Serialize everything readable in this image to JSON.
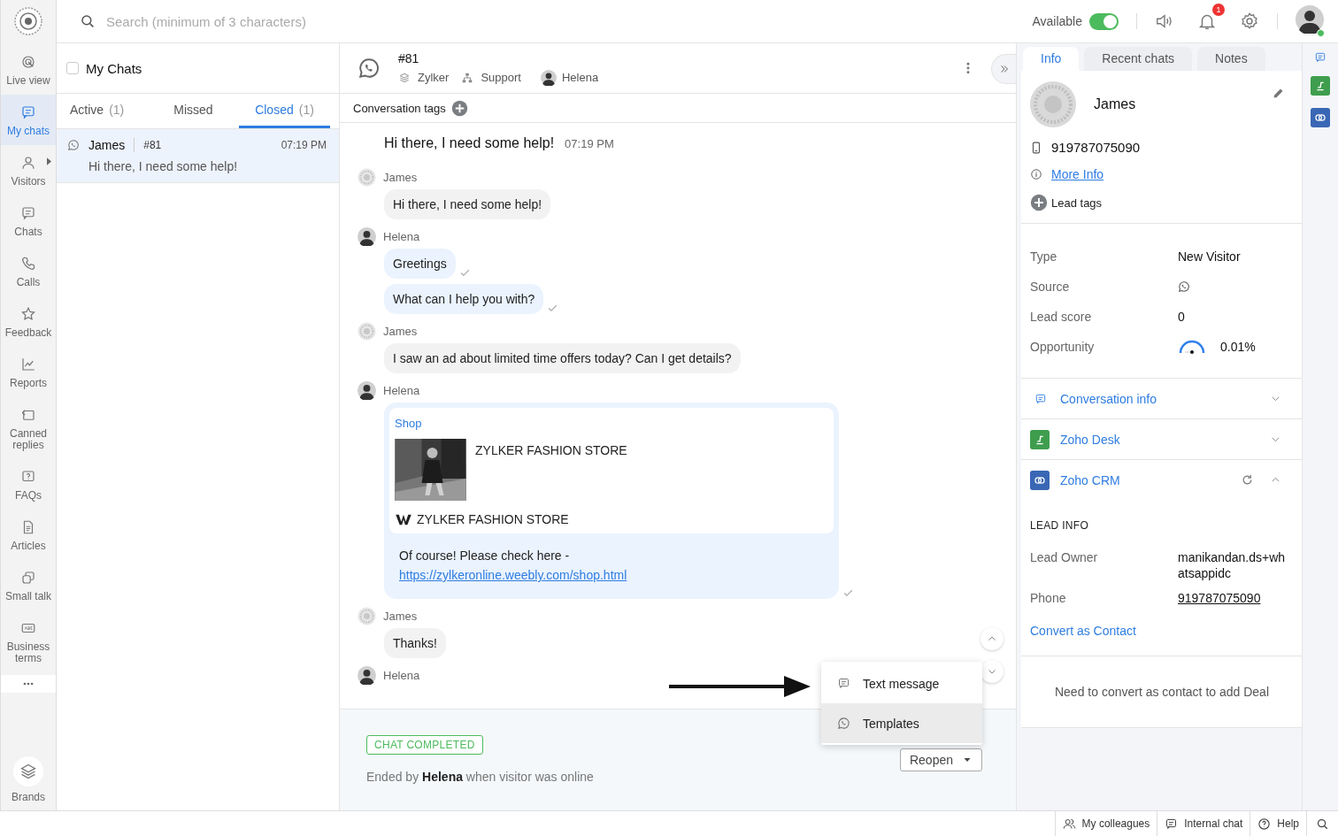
{
  "nav": {
    "items": [
      {
        "label": "Live view",
        "selected": false,
        "has_submenu": false
      },
      {
        "label": "My chats",
        "selected": true,
        "has_submenu": false
      },
      {
        "label": "Visitors",
        "selected": false,
        "has_submenu": true
      },
      {
        "label": "Chats",
        "selected": false,
        "has_submenu": false
      },
      {
        "label": "Calls",
        "selected": false,
        "has_submenu": false
      },
      {
        "label": "Feedback",
        "selected": false,
        "has_submenu": false
      },
      {
        "label": "Reports",
        "selected": false,
        "has_submenu": false
      },
      {
        "label": "Canned replies",
        "selected": false,
        "has_submenu": false
      },
      {
        "label": "FAQs",
        "selected": false,
        "has_submenu": false
      },
      {
        "label": "Articles",
        "selected": false,
        "has_submenu": false
      },
      {
        "label": "Small talk",
        "selected": false,
        "has_submenu": false
      },
      {
        "label": "Business terms",
        "selected": false,
        "has_submenu": false
      }
    ],
    "bottom_item": {
      "label": "Brands"
    }
  },
  "topbar": {
    "search": {
      "placeholder": "Search (minimum of 3 characters)"
    },
    "availability": {
      "label": "Available",
      "on": true
    },
    "notification_count": "1"
  },
  "chat_list": {
    "title": "My Chats",
    "select_all_checked": false,
    "tabs": [
      {
        "label": "Active",
        "count": "(1)",
        "selected": false
      },
      {
        "label": "Missed",
        "selected": false
      },
      {
        "label": "Closed",
        "count": "(1)",
        "selected": true
      }
    ],
    "chats": [
      {
        "name": "James",
        "number": "#81",
        "time": "07:19 PM",
        "preview": "Hi there, I need some help!",
        "selected": true
      }
    ]
  },
  "conversation": {
    "number": "#81",
    "brand": "Zylker",
    "department": "Support",
    "agent": "Helena",
    "tags_label": "Conversation tags",
    "messages": [
      {
        "kind": "headline",
        "text": "Hi there, I need some help!",
        "time": "07:19 PM"
      },
      {
        "kind": "group",
        "sender": "James",
        "from_agent": false,
        "bubbles": [
          {
            "text": "Hi there, I need some help!",
            "delivered": false
          }
        ]
      },
      {
        "kind": "group",
        "sender": "Helena",
        "from_agent": true,
        "bubbles": [
          {
            "text": "Greetings",
            "delivered": true
          },
          {
            "text": "What can I help you with?",
            "delivered": true
          }
        ]
      },
      {
        "kind": "group",
        "sender": "James",
        "from_agent": false,
        "bubbles": [
          {
            "text": "I saw an ad about limited time offers today? Can I get details?",
            "delivered": false
          }
        ]
      },
      {
        "kind": "card",
        "sender": "Helena",
        "from_agent": true,
        "link_label": "Shop",
        "product_title": "ZYLKER FASHION STORE",
        "store_name": "ZYLKER FASHION STORE",
        "text": "Of course! Please check here -",
        "url": "https://zylkeronline.weebly.com/shop.html",
        "delivered": true
      },
      {
        "kind": "group",
        "sender": "James",
        "from_agent": false,
        "bubbles": [
          {
            "text": "Thanks!",
            "delivered": false
          }
        ]
      },
      {
        "kind": "group",
        "sender": "Helena",
        "from_agent": true
      }
    ],
    "reply_menu": [
      {
        "label": "Text message",
        "highlighted": false,
        "kind": "text"
      },
      {
        "label": "Templates",
        "highlighted": true,
        "kind": "whatsapp"
      }
    ],
    "footer": {
      "status": "CHAT COMPLETED",
      "ended_text": "Ended by **Helena** when visitor was online",
      "reopen_label": "Reopen"
    }
  },
  "details": {
    "tabs": [
      {
        "label": "Info",
        "selected": true
      },
      {
        "label": "Recent chats",
        "selected": false
      },
      {
        "label": "Notes",
        "selected": false
      }
    ],
    "visitor_name": "James",
    "phone": "919787075090",
    "more_info": "More Info",
    "lead_tags": "Lead tags",
    "fields": [
      {
        "label": "Type",
        "kind": "text",
        "value": "New Visitor"
      },
      {
        "label": "Source",
        "kind": "whatsapp"
      },
      {
        "label": "Lead score",
        "kind": "text",
        "value": "0"
      },
      {
        "label": "Opportunity",
        "kind": "gauge",
        "value": "0.01%"
      }
    ],
    "sections": [
      {
        "title": "Conversation info",
        "kind": "chat",
        "expanded": false
      },
      {
        "title": "Zoho Desk",
        "kind": "desk",
        "expanded": false
      },
      {
        "title": "Zoho CRM",
        "kind": "crm",
        "expanded": true,
        "heading": "LEAD INFO",
        "fields": [
          {
            "label": "Lead Owner",
            "value": "manikandan.ds+whatsappidc",
            "underlined": false
          },
          {
            "label": "Phone",
            "value": "919787075090",
            "underlined": true
          }
        ],
        "action": "Convert as Contact"
      }
    ],
    "deal_note": "Need to convert as contact to add Deal"
  },
  "status_bar": {
    "items": [
      {
        "label": "My colleagues",
        "kind": "people"
      },
      {
        "label": "Internal chat",
        "kind": "chat"
      },
      {
        "label": "Help",
        "kind": "help"
      }
    ]
  }
}
